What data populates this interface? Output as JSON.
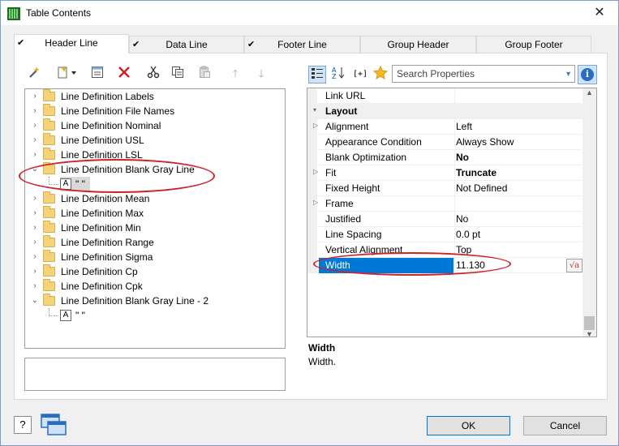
{
  "window": {
    "title": "Table Contents",
    "close": "✕"
  },
  "tabs": [
    {
      "label": "Header Line",
      "checked": true,
      "active": true
    },
    {
      "label": "Data Line",
      "checked": true,
      "active": false
    },
    {
      "label": "Footer Line",
      "checked": true,
      "active": false
    },
    {
      "label": "Group Header",
      "checked": false,
      "active": false
    },
    {
      "label": "Group Footer",
      "checked": false,
      "active": false
    }
  ],
  "left_toolbar": [
    {
      "icon": "wizard-icon"
    },
    {
      "icon": "new-item-icon"
    },
    {
      "icon": "properties-icon"
    },
    {
      "icon": "delete-icon"
    },
    {
      "icon": "cut-icon"
    },
    {
      "icon": "copy-icon"
    },
    {
      "icon": "paste-icon"
    },
    {
      "icon": "move-up-icon"
    },
    {
      "icon": "move-down-icon"
    }
  ],
  "tree": {
    "items": [
      {
        "label": "Line Definition Labels",
        "expanded": false
      },
      {
        "label": "Line Definition File Names",
        "expanded": false
      },
      {
        "label": "Line Definition Nominal",
        "expanded": false
      },
      {
        "label": "Line Definition USL",
        "expanded": false
      },
      {
        "label": "Line Definition LSL",
        "expanded": false
      },
      {
        "label": "Line Definition Blank Gray Line",
        "expanded": true,
        "child": "\" \""
      },
      {
        "label": "Line Definition Mean",
        "expanded": false
      },
      {
        "label": "Line Definition Max",
        "expanded": false
      },
      {
        "label": "Line Definition Min",
        "expanded": false
      },
      {
        "label": "Line Definition Range",
        "expanded": false
      },
      {
        "label": "Line Definition Sigma",
        "expanded": false
      },
      {
        "label": "Line Definition Cp",
        "expanded": false
      },
      {
        "label": "Line Definition Cpk",
        "expanded": false
      },
      {
        "label": "Line Definition Blank Gray Line - 2",
        "expanded": true,
        "child": "\" \""
      }
    ]
  },
  "properties": {
    "search_placeholder": "Search Properties",
    "rows": [
      {
        "name": "Link URL",
        "value": "",
        "type": "normal"
      },
      {
        "name": "Layout",
        "value": "",
        "type": "category"
      },
      {
        "name": "Alignment",
        "value": "Left",
        "type": "normal",
        "expandable": true
      },
      {
        "name": "Appearance Condition",
        "value": "Always Show",
        "type": "normal"
      },
      {
        "name": "Blank Optimization",
        "value": "No",
        "type": "normal",
        "bold": true
      },
      {
        "name": "Fit",
        "value": "Truncate",
        "type": "normal",
        "bold": true,
        "expandable": true
      },
      {
        "name": "Fixed Height",
        "value": "Not Defined",
        "type": "normal"
      },
      {
        "name": "Frame",
        "value": "",
        "type": "normal",
        "expandable": true
      },
      {
        "name": "Justified",
        "value": "No",
        "type": "normal"
      },
      {
        "name": "Line Spacing",
        "value": "0.0 pt",
        "type": "normal"
      },
      {
        "name": "Vertical Alignment",
        "value": "Top",
        "type": "normal"
      },
      {
        "name": "Width",
        "value": "11.130",
        "type": "selected"
      }
    ],
    "help_title": "Width",
    "help_text": "Width."
  },
  "buttons": {
    "ok": "OK",
    "cancel": "Cancel"
  },
  "colors": {
    "selection": "#0078d7",
    "annotation": "#d0202a",
    "folder": "#f3d27a"
  }
}
